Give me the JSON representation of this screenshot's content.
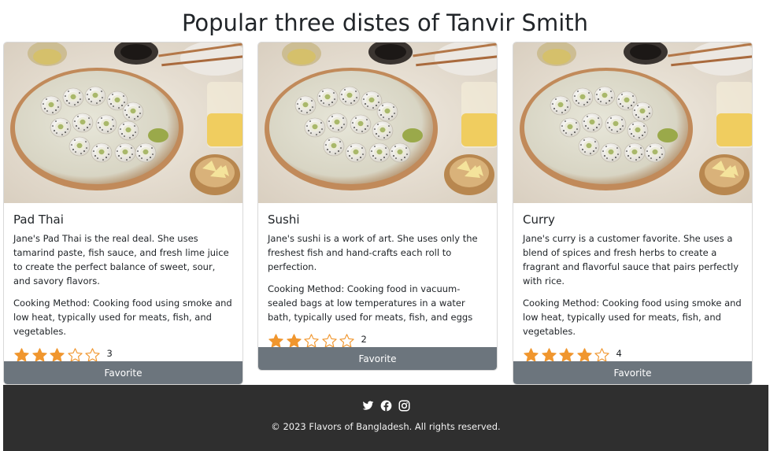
{
  "page": {
    "title": "Popular three distes of Tanvir Smith"
  },
  "colors": {
    "star_fill": "#f0962e",
    "star_empty": "#f0962e",
    "button_bg": "#6c757d",
    "footer_bg": "#2f2f2f"
  },
  "cards": [
    {
      "image_icon": "sushi-photo",
      "name": "Pad Thai",
      "description": "Jane's Pad Thai is the real deal. She uses tamarind paste, fish sauce, and fresh lime juice to create the perfect balance of sweet, sour, and savory flavors.",
      "cooking_method": "Cooking Method: Cooking food using smoke and low heat, typically used for meats, fish, and vegetables.",
      "rating": 3,
      "rating_max": 5,
      "rating_label": "3",
      "button_label": "Favorite"
    },
    {
      "image_icon": "sushi-photo",
      "name": "Sushi",
      "description": "Jane's sushi is a work of art. She uses only the freshest fish and hand-crafts each roll to perfection.",
      "cooking_method": "Cooking Method: Cooking food in vacuum-sealed bags at low temperatures in a water bath, typically used for meats, fish, and eggs",
      "rating": 2,
      "rating_max": 5,
      "rating_label": "2",
      "button_label": "Favorite"
    },
    {
      "image_icon": "sushi-photo",
      "name": "Curry",
      "description": "Jane's curry is a customer favorite. She uses a blend of spices and fresh herbs to create a fragrant and flavorful sauce that pairs perfectly with rice.",
      "cooking_method": "Cooking Method: Cooking food using smoke and low heat, typically used for meats, fish, and vegetables.",
      "rating": 4,
      "rating_max": 5,
      "rating_label": "4",
      "button_label": "Favorite"
    }
  ],
  "footer": {
    "social_icons": [
      "twitter-icon",
      "facebook-icon",
      "instagram-icon"
    ],
    "copyright": "© 2023 Flavors of Bangladesh. All rights reserved."
  }
}
